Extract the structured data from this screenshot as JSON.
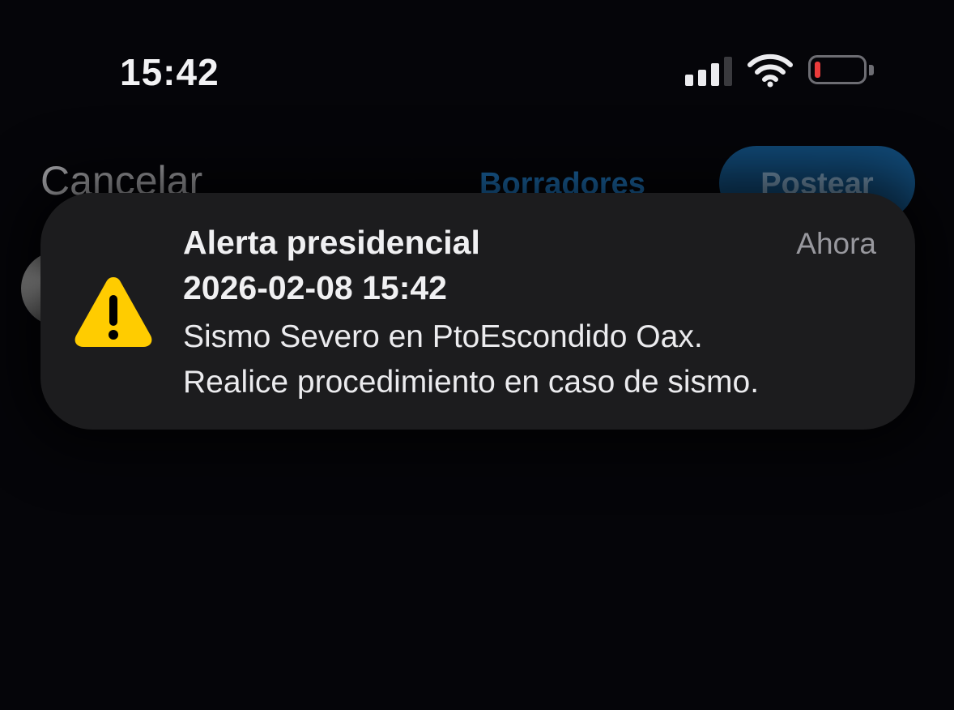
{
  "status_bar": {
    "time": "15:42",
    "battery_level_fraction": 0.08,
    "battery_color": "#eb3b3b",
    "icons": [
      "cellular-signal-icon",
      "wifi-icon",
      "battery-icon"
    ]
  },
  "compose": {
    "cancel_label": "Cancelar",
    "drafts_label": "Borradores",
    "post_label": "Postear",
    "accent_color": "#1d6fb3"
  },
  "notification": {
    "icon": "warning-triangle-icon",
    "icon_color": "#ffcc00",
    "title": "Alerta presidencial",
    "date": "2026-02-08 15:42",
    "time_label": "Ahora",
    "body_lines": [
      "Sismo Severo en PtoEscondido Oax.",
      "Realice procedimiento en caso de sismo."
    ]
  }
}
